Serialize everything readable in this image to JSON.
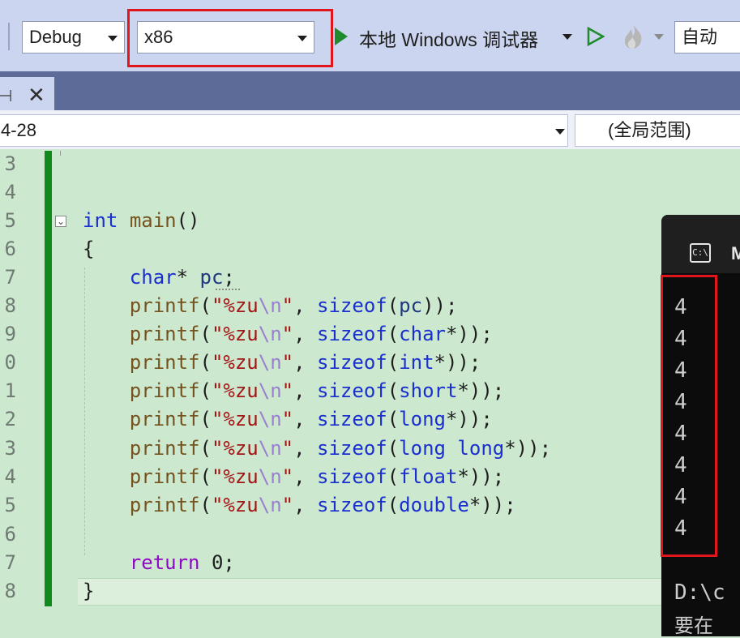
{
  "toolbar": {
    "configuration": "Debug",
    "platform": "x86",
    "debugger_label": "本地 Windows 调试器",
    "auto_label": "自动"
  },
  "navbar": {
    "scope_left": "4-28",
    "scope_right": "(全局范围)"
  },
  "editor": {
    "line_numbers": [
      "3",
      "4",
      "5",
      "6",
      "7",
      "8",
      "9",
      "0",
      "1",
      "2",
      "3",
      "4",
      "5",
      "6",
      "7",
      "8"
    ],
    "code": {
      "l5_kw": "int",
      "l5_fn": "main",
      "l5_rest": "()",
      "l6": "{",
      "l7_kw": "char",
      "l7_star": "* ",
      "l7_var": "pc",
      "l7_end": ";",
      "printf": "printf",
      "str_open": "\"%zu",
      "esc": "\\n",
      "str_close": "\"",
      "sizeof": "sizeof",
      "l8_arg": "pc",
      "l9_kw": "char",
      "l10_kw": "int",
      "l11_kw": "short",
      "l12_kw": "long",
      "l13_kw1": "long",
      "l13_kw2": "long",
      "l14_kw": "float",
      "l15_kw": "double",
      "l17_kw": "return",
      "l17_rest": " 0;",
      "l18": "}"
    }
  },
  "console": {
    "title": "M",
    "icon_text": "C:\\",
    "outputs": [
      "4",
      "4",
      "4",
      "4",
      "4",
      "4",
      "4",
      "4"
    ],
    "path_line": "D:\\c",
    "cjk_line": "要在"
  }
}
